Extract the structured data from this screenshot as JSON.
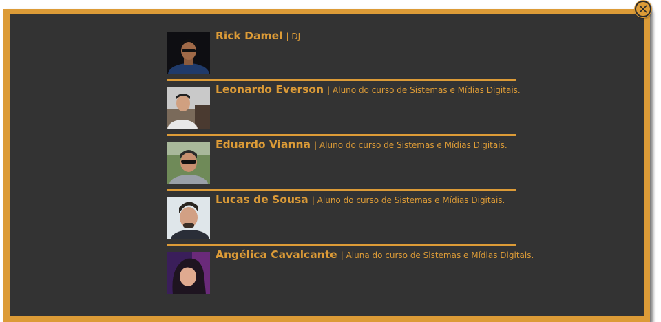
{
  "colors": {
    "accent": "#dc9b37",
    "panel": "#333333"
  },
  "close_button": {
    "icon": "close-icon"
  },
  "members": [
    {
      "name": "Rick Damel",
      "role": "| DJ"
    },
    {
      "name": "Leonardo Everson",
      "role": "| Aluno do curso de Sistemas e Mídias Digitais."
    },
    {
      "name": "Eduardo Vianna",
      "role": "| Aluno do curso de Sistemas e Mídias Digitais."
    },
    {
      "name": "Lucas de Sousa",
      "role": "| Aluno do curso de Sistemas e Mídias Digitais."
    },
    {
      "name": "Angélica Cavalcante",
      "role": "| Aluna do curso de Sistemas e Mídias Digitais."
    }
  ]
}
